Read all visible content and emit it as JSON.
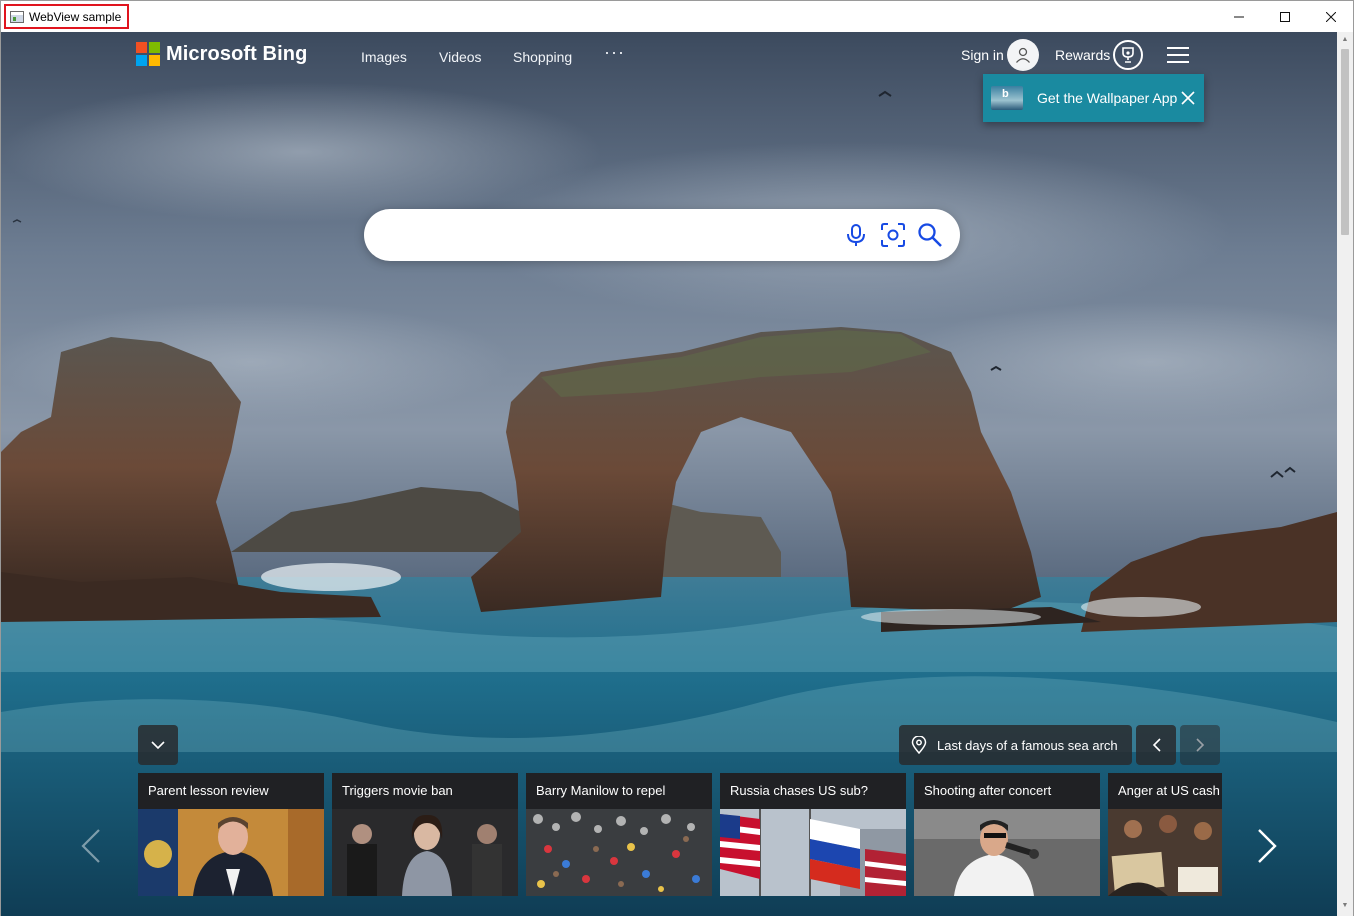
{
  "window": {
    "title": "WebView sample"
  },
  "header": {
    "brand": "Microsoft Bing",
    "nav": [
      "Images",
      "Videos",
      "Shopping"
    ],
    "more_label": "···",
    "sign_in": "Sign in",
    "rewards": "Rewards"
  },
  "promo": {
    "text": "Get the Wallpaper App"
  },
  "search": {
    "value": "",
    "placeholder": ""
  },
  "caption": {
    "text": "Last days of a famous sea arch"
  },
  "news": [
    {
      "title": "Parent lesson review"
    },
    {
      "title": "Triggers movie ban"
    },
    {
      "title": "Barry Manilow to repel"
    },
    {
      "title": "Russia chases US sub?"
    },
    {
      "title": "Shooting after concert"
    },
    {
      "title": "Anger at US cash s"
    }
  ],
  "colors": {
    "promo": "#1a8aa0",
    "close_highlight": "#e0141e"
  }
}
